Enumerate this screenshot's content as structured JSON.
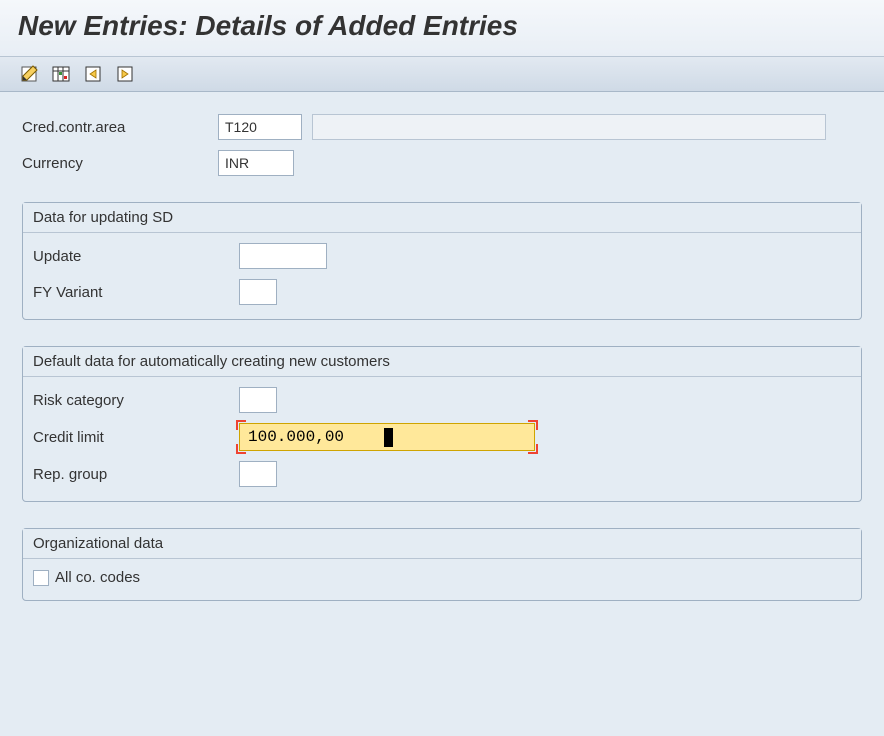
{
  "title": "New Entries: Details of Added Entries",
  "toolbar": {
    "edit_label": "Edit",
    "table_label": "Table Settings",
    "nav_prev_label": "Previous",
    "nav_next_label": "Next"
  },
  "fields": {
    "cred_contr_area": {
      "label": "Cred.contr.area",
      "value": "T120",
      "desc_value": ""
    },
    "currency": {
      "label": "Currency",
      "value": "INR"
    }
  },
  "group_sd": {
    "title": "Data for updating SD",
    "update": {
      "label": "Update",
      "value": ""
    },
    "fy_variant": {
      "label": "FY Variant",
      "value": ""
    }
  },
  "group_default": {
    "title": "Default data for automatically creating new customers",
    "risk_category": {
      "label": "Risk category",
      "value": ""
    },
    "credit_limit": {
      "label": "Credit limit",
      "value": "100.000,00"
    },
    "rep_group": {
      "label": "Rep. group",
      "value": ""
    }
  },
  "group_org": {
    "title": "Organizational data",
    "all_co_codes": {
      "label": "All co. codes",
      "checked": false
    }
  }
}
